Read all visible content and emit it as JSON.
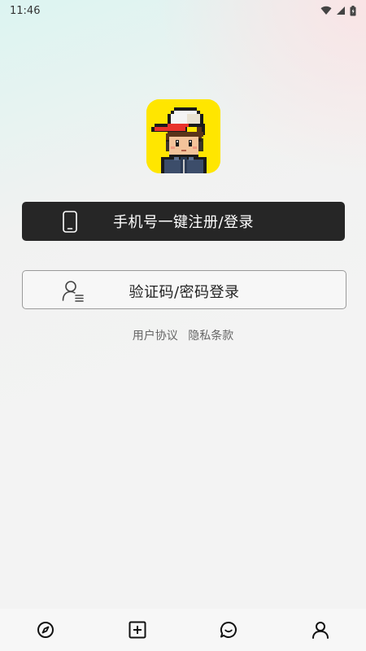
{
  "status_bar": {
    "time": "11:46"
  },
  "app": {
    "logo_icon": "pixel-boy-avatar-icon",
    "accent_color": "#ffe600"
  },
  "login": {
    "phone_button_label": "手机号一键注册/登录",
    "code_password_button_label": "验证码/密码登录"
  },
  "agreements": {
    "user_agreement": "用户协议",
    "privacy_policy": "隐私条款"
  },
  "bottom_nav": {
    "items": [
      {
        "icon": "compass-icon"
      },
      {
        "icon": "add-square-icon"
      },
      {
        "icon": "chat-bubble-icon"
      },
      {
        "icon": "profile-icon"
      }
    ]
  }
}
